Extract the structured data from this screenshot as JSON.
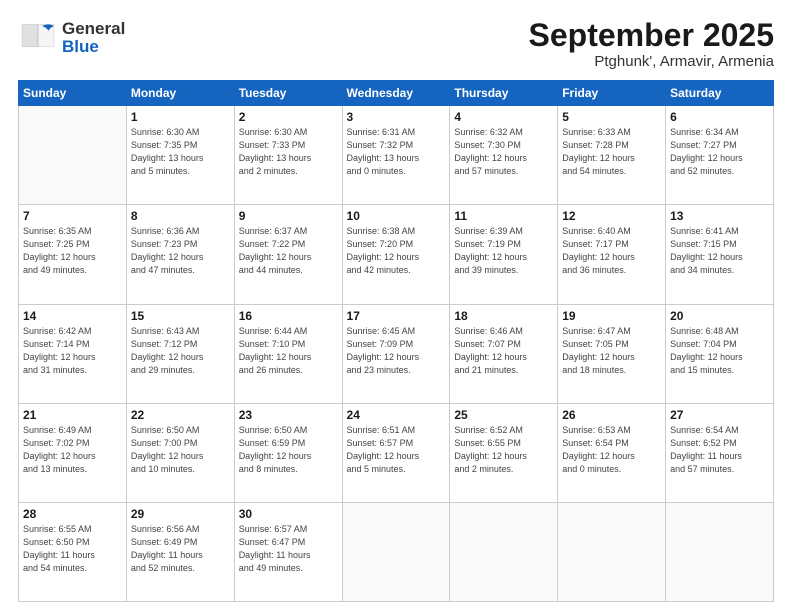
{
  "header": {
    "logo_general": "General",
    "logo_blue": "Blue",
    "title": "September 2025",
    "subtitle": "Ptghunk', Armavir, Armenia"
  },
  "columns": [
    "Sunday",
    "Monday",
    "Tuesday",
    "Wednesday",
    "Thursday",
    "Friday",
    "Saturday"
  ],
  "weeks": [
    [
      {
        "day": "",
        "info": ""
      },
      {
        "day": "1",
        "info": "Sunrise: 6:30 AM\nSunset: 7:35 PM\nDaylight: 13 hours\nand 5 minutes."
      },
      {
        "day": "2",
        "info": "Sunrise: 6:30 AM\nSunset: 7:33 PM\nDaylight: 13 hours\nand 2 minutes."
      },
      {
        "day": "3",
        "info": "Sunrise: 6:31 AM\nSunset: 7:32 PM\nDaylight: 13 hours\nand 0 minutes."
      },
      {
        "day": "4",
        "info": "Sunrise: 6:32 AM\nSunset: 7:30 PM\nDaylight: 12 hours\nand 57 minutes."
      },
      {
        "day": "5",
        "info": "Sunrise: 6:33 AM\nSunset: 7:28 PM\nDaylight: 12 hours\nand 54 minutes."
      },
      {
        "day": "6",
        "info": "Sunrise: 6:34 AM\nSunset: 7:27 PM\nDaylight: 12 hours\nand 52 minutes."
      }
    ],
    [
      {
        "day": "7",
        "info": "Sunrise: 6:35 AM\nSunset: 7:25 PM\nDaylight: 12 hours\nand 49 minutes."
      },
      {
        "day": "8",
        "info": "Sunrise: 6:36 AM\nSunset: 7:23 PM\nDaylight: 12 hours\nand 47 minutes."
      },
      {
        "day": "9",
        "info": "Sunrise: 6:37 AM\nSunset: 7:22 PM\nDaylight: 12 hours\nand 44 minutes."
      },
      {
        "day": "10",
        "info": "Sunrise: 6:38 AM\nSunset: 7:20 PM\nDaylight: 12 hours\nand 42 minutes."
      },
      {
        "day": "11",
        "info": "Sunrise: 6:39 AM\nSunset: 7:19 PM\nDaylight: 12 hours\nand 39 minutes."
      },
      {
        "day": "12",
        "info": "Sunrise: 6:40 AM\nSunset: 7:17 PM\nDaylight: 12 hours\nand 36 minutes."
      },
      {
        "day": "13",
        "info": "Sunrise: 6:41 AM\nSunset: 7:15 PM\nDaylight: 12 hours\nand 34 minutes."
      }
    ],
    [
      {
        "day": "14",
        "info": "Sunrise: 6:42 AM\nSunset: 7:14 PM\nDaylight: 12 hours\nand 31 minutes."
      },
      {
        "day": "15",
        "info": "Sunrise: 6:43 AM\nSunset: 7:12 PM\nDaylight: 12 hours\nand 29 minutes."
      },
      {
        "day": "16",
        "info": "Sunrise: 6:44 AM\nSunset: 7:10 PM\nDaylight: 12 hours\nand 26 minutes."
      },
      {
        "day": "17",
        "info": "Sunrise: 6:45 AM\nSunset: 7:09 PM\nDaylight: 12 hours\nand 23 minutes."
      },
      {
        "day": "18",
        "info": "Sunrise: 6:46 AM\nSunset: 7:07 PM\nDaylight: 12 hours\nand 21 minutes."
      },
      {
        "day": "19",
        "info": "Sunrise: 6:47 AM\nSunset: 7:05 PM\nDaylight: 12 hours\nand 18 minutes."
      },
      {
        "day": "20",
        "info": "Sunrise: 6:48 AM\nSunset: 7:04 PM\nDaylight: 12 hours\nand 15 minutes."
      }
    ],
    [
      {
        "day": "21",
        "info": "Sunrise: 6:49 AM\nSunset: 7:02 PM\nDaylight: 12 hours\nand 13 minutes."
      },
      {
        "day": "22",
        "info": "Sunrise: 6:50 AM\nSunset: 7:00 PM\nDaylight: 12 hours\nand 10 minutes."
      },
      {
        "day": "23",
        "info": "Sunrise: 6:50 AM\nSunset: 6:59 PM\nDaylight: 12 hours\nand 8 minutes."
      },
      {
        "day": "24",
        "info": "Sunrise: 6:51 AM\nSunset: 6:57 PM\nDaylight: 12 hours\nand 5 minutes."
      },
      {
        "day": "25",
        "info": "Sunrise: 6:52 AM\nSunset: 6:55 PM\nDaylight: 12 hours\nand 2 minutes."
      },
      {
        "day": "26",
        "info": "Sunrise: 6:53 AM\nSunset: 6:54 PM\nDaylight: 12 hours\nand 0 minutes."
      },
      {
        "day": "27",
        "info": "Sunrise: 6:54 AM\nSunset: 6:52 PM\nDaylight: 11 hours\nand 57 minutes."
      }
    ],
    [
      {
        "day": "28",
        "info": "Sunrise: 6:55 AM\nSunset: 6:50 PM\nDaylight: 11 hours\nand 54 minutes."
      },
      {
        "day": "29",
        "info": "Sunrise: 6:56 AM\nSunset: 6:49 PM\nDaylight: 11 hours\nand 52 minutes."
      },
      {
        "day": "30",
        "info": "Sunrise: 6:57 AM\nSunset: 6:47 PM\nDaylight: 11 hours\nand 49 minutes."
      },
      {
        "day": "",
        "info": ""
      },
      {
        "day": "",
        "info": ""
      },
      {
        "day": "",
        "info": ""
      },
      {
        "day": "",
        "info": ""
      }
    ]
  ]
}
